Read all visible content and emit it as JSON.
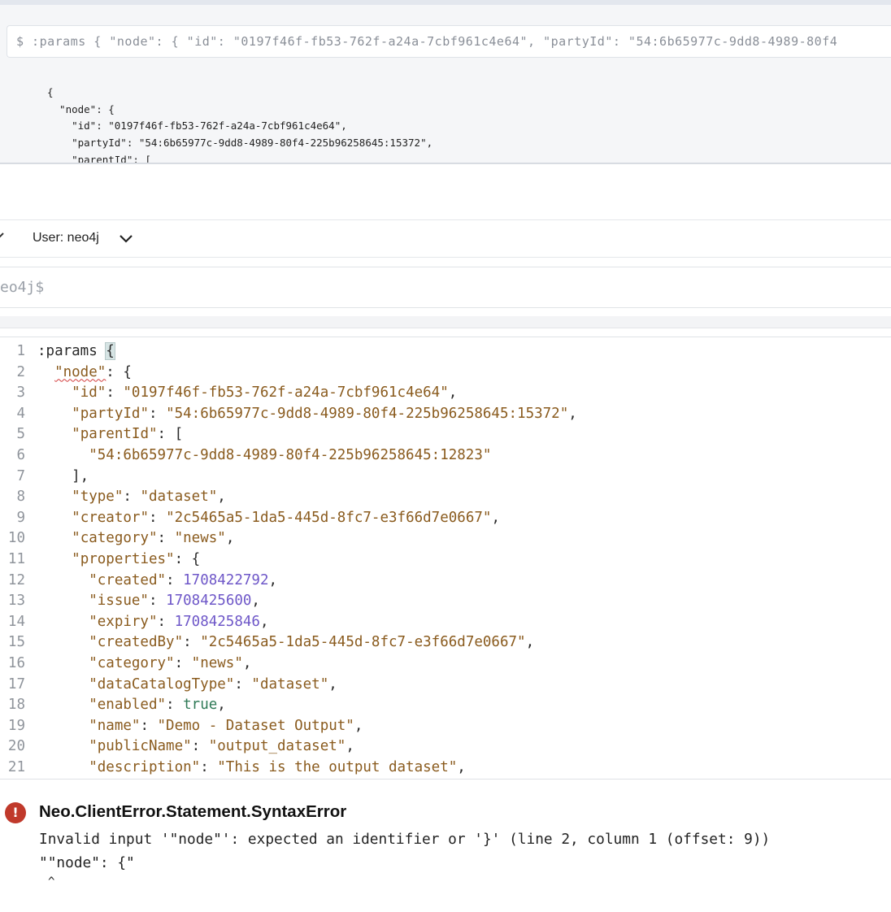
{
  "result_frame": {
    "command": "$ :params { \"node\": { \"id\": \"0197f46f-fb53-762f-a24a-7cbf961c4e64\", \"partyId\": \"54:6b65977c-9dd8-4989-80f4",
    "json_preview": "{\n  \"node\": {\n    \"id\": \"0197f46f-fb53-762f-a24a-7cbf961c4e64\",\n    \"partyId\": \"54:6b65977c-9dd8-4989-80f4-225b96258645:15372\",\n    \"parentId\": ["
  },
  "user_menu": {
    "label": "User: neo4j"
  },
  "prompt": {
    "text": "eo4j$"
  },
  "editor": {
    "lines": [
      {
        "n": "1",
        "parts": [
          {
            "t": ":params ",
            "c": "kw"
          },
          {
            "t": "{",
            "c": "kw bracket-hl"
          }
        ]
      },
      {
        "n": "2",
        "parts": [
          {
            "t": "  ",
            "c": "kw"
          },
          {
            "t": "\"node\"",
            "c": "key squiggle"
          },
          {
            "t": ": {",
            "c": "kw"
          }
        ]
      },
      {
        "n": "3",
        "parts": [
          {
            "t": "    ",
            "c": "kw"
          },
          {
            "t": "\"id\"",
            "c": "key"
          },
          {
            "t": ": ",
            "c": "kw"
          },
          {
            "t": "\"0197f46f-fb53-762f-a24a-7cbf961c4e64\"",
            "c": "str"
          },
          {
            "t": ",",
            "c": "kw"
          }
        ]
      },
      {
        "n": "4",
        "parts": [
          {
            "t": "    ",
            "c": "kw"
          },
          {
            "t": "\"partyId\"",
            "c": "key"
          },
          {
            "t": ": ",
            "c": "kw"
          },
          {
            "t": "\"54:6b65977c-9dd8-4989-80f4-225b96258645:15372\"",
            "c": "str"
          },
          {
            "t": ",",
            "c": "kw"
          }
        ]
      },
      {
        "n": "5",
        "parts": [
          {
            "t": "    ",
            "c": "kw"
          },
          {
            "t": "\"parentId\"",
            "c": "key"
          },
          {
            "t": ": [",
            "c": "kw"
          }
        ]
      },
      {
        "n": "6",
        "parts": [
          {
            "t": "      ",
            "c": "kw"
          },
          {
            "t": "\"54:6b65977c-9dd8-4989-80f4-225b96258645:12823\"",
            "c": "str"
          }
        ]
      },
      {
        "n": "7",
        "parts": [
          {
            "t": "    ],",
            "c": "kw"
          }
        ]
      },
      {
        "n": "8",
        "parts": [
          {
            "t": "    ",
            "c": "kw"
          },
          {
            "t": "\"type\"",
            "c": "key"
          },
          {
            "t": ": ",
            "c": "kw"
          },
          {
            "t": "\"dataset\"",
            "c": "str"
          },
          {
            "t": ",",
            "c": "kw"
          }
        ]
      },
      {
        "n": "9",
        "parts": [
          {
            "t": "    ",
            "c": "kw"
          },
          {
            "t": "\"creator\"",
            "c": "key"
          },
          {
            "t": ": ",
            "c": "kw"
          },
          {
            "t": "\"2c5465a5-1da5-445d-8fc7-e3f66d7e0667\"",
            "c": "str"
          },
          {
            "t": ",",
            "c": "kw"
          }
        ]
      },
      {
        "n": "10",
        "parts": [
          {
            "t": "    ",
            "c": "kw"
          },
          {
            "t": "\"category\"",
            "c": "key"
          },
          {
            "t": ": ",
            "c": "kw"
          },
          {
            "t": "\"news\"",
            "c": "str"
          },
          {
            "t": ",",
            "c": "kw"
          }
        ]
      },
      {
        "n": "11",
        "parts": [
          {
            "t": "    ",
            "c": "kw"
          },
          {
            "t": "\"properties\"",
            "c": "key"
          },
          {
            "t": ": {",
            "c": "kw"
          }
        ]
      },
      {
        "n": "12",
        "parts": [
          {
            "t": "      ",
            "c": "kw"
          },
          {
            "t": "\"created\"",
            "c": "key"
          },
          {
            "t": ": ",
            "c": "kw"
          },
          {
            "t": "1708422792",
            "c": "num"
          },
          {
            "t": ",",
            "c": "kw"
          }
        ]
      },
      {
        "n": "13",
        "parts": [
          {
            "t": "      ",
            "c": "kw"
          },
          {
            "t": "\"issue\"",
            "c": "key"
          },
          {
            "t": ": ",
            "c": "kw"
          },
          {
            "t": "1708425600",
            "c": "num"
          },
          {
            "t": ",",
            "c": "kw"
          }
        ]
      },
      {
        "n": "14",
        "parts": [
          {
            "t": "      ",
            "c": "kw"
          },
          {
            "t": "\"expiry\"",
            "c": "key"
          },
          {
            "t": ": ",
            "c": "kw"
          },
          {
            "t": "1708425846",
            "c": "num"
          },
          {
            "t": ",",
            "c": "kw"
          }
        ]
      },
      {
        "n": "15",
        "parts": [
          {
            "t": "      ",
            "c": "kw"
          },
          {
            "t": "\"createdBy\"",
            "c": "key"
          },
          {
            "t": ": ",
            "c": "kw"
          },
          {
            "t": "\"2c5465a5-1da5-445d-8fc7-e3f66d7e0667\"",
            "c": "str"
          },
          {
            "t": ",",
            "c": "kw"
          }
        ]
      },
      {
        "n": "16",
        "parts": [
          {
            "t": "      ",
            "c": "kw"
          },
          {
            "t": "\"category\"",
            "c": "key"
          },
          {
            "t": ": ",
            "c": "kw"
          },
          {
            "t": "\"news\"",
            "c": "str"
          },
          {
            "t": ",",
            "c": "kw"
          }
        ]
      },
      {
        "n": "17",
        "parts": [
          {
            "t": "      ",
            "c": "kw"
          },
          {
            "t": "\"dataCatalogType\"",
            "c": "key"
          },
          {
            "t": ": ",
            "c": "kw"
          },
          {
            "t": "\"dataset\"",
            "c": "str"
          },
          {
            "t": ",",
            "c": "kw"
          }
        ]
      },
      {
        "n": "18",
        "parts": [
          {
            "t": "      ",
            "c": "kw"
          },
          {
            "t": "\"enabled\"",
            "c": "key"
          },
          {
            "t": ": ",
            "c": "kw"
          },
          {
            "t": "true",
            "c": "bool"
          },
          {
            "t": ",",
            "c": "kw"
          }
        ]
      },
      {
        "n": "19",
        "parts": [
          {
            "t": "      ",
            "c": "kw"
          },
          {
            "t": "\"name\"",
            "c": "key"
          },
          {
            "t": ": ",
            "c": "kw"
          },
          {
            "t": "\"Demo - Dataset Output\"",
            "c": "str"
          },
          {
            "t": ",",
            "c": "kw"
          }
        ]
      },
      {
        "n": "20",
        "parts": [
          {
            "t": "      ",
            "c": "kw"
          },
          {
            "t": "\"publicName\"",
            "c": "key"
          },
          {
            "t": ": ",
            "c": "kw"
          },
          {
            "t": "\"output_dataset\"",
            "c": "str"
          },
          {
            "t": ",",
            "c": "kw"
          }
        ]
      },
      {
        "n": "21",
        "parts": [
          {
            "t": "      ",
            "c": "kw"
          },
          {
            "t": "\"description\"",
            "c": "key"
          },
          {
            "t": ": ",
            "c": "kw"
          },
          {
            "t": "\"This is the output dataset\"",
            "c": "str"
          },
          {
            "t": ",",
            "c": "kw"
          }
        ]
      }
    ]
  },
  "error": {
    "icon": "!",
    "title": "Neo.ClientError.Statement.SyntaxError",
    "message": "Invalid input '\"node\"': expected an identifier or '}' (line 2, column 1 (offset: 9))",
    "snippet": "\"\"node\": {\"",
    "caret": "^"
  },
  "colors": {
    "string": "#8a5b1e",
    "number": "#6e57c8",
    "boolean": "#2f7a57",
    "error_icon": "#c0392b"
  },
  "icons": {
    "user_dropdown": "chevron-down-icon",
    "left_toggle": "chevron-icon",
    "error": "error-icon"
  }
}
